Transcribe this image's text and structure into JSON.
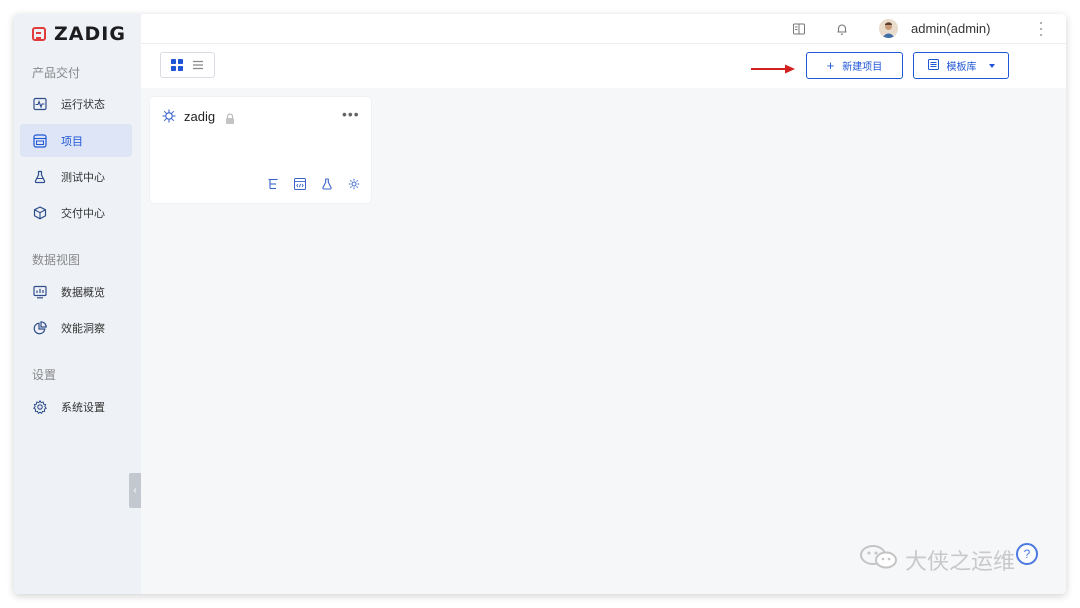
{
  "app": {
    "logo_text": "ZADIG",
    "brand_color": "#e23b3b",
    "accent_color": "#1f56d6"
  },
  "sidebar": {
    "sections": [
      {
        "title": "产品交付",
        "items": [
          {
            "label": "运行状态",
            "icon": "monitor-pulse-icon",
            "active": false
          },
          {
            "label": "项目",
            "icon": "project-icon",
            "active": true
          },
          {
            "label": "测试中心",
            "icon": "flask-icon",
            "active": false
          },
          {
            "label": "交付中心",
            "icon": "package-icon",
            "active": false
          }
        ]
      },
      {
        "title": "数据视图",
        "items": [
          {
            "label": "数据概览",
            "icon": "dashboard-chart-icon",
            "active": false
          },
          {
            "label": "效能洞察",
            "icon": "pie-chart-icon",
            "active": false
          }
        ]
      },
      {
        "title": "设置",
        "items": [
          {
            "label": "系统设置",
            "icon": "gear-icon",
            "active": false
          }
        ]
      }
    ]
  },
  "header": {
    "username": "admin(admin)"
  },
  "toolbar": {
    "new_project_label": "新建项目",
    "template_lib_label": "模板库"
  },
  "projects": [
    {
      "name": "zadig",
      "private": true
    }
  ],
  "watermark": {
    "text": "大侠之运维"
  }
}
